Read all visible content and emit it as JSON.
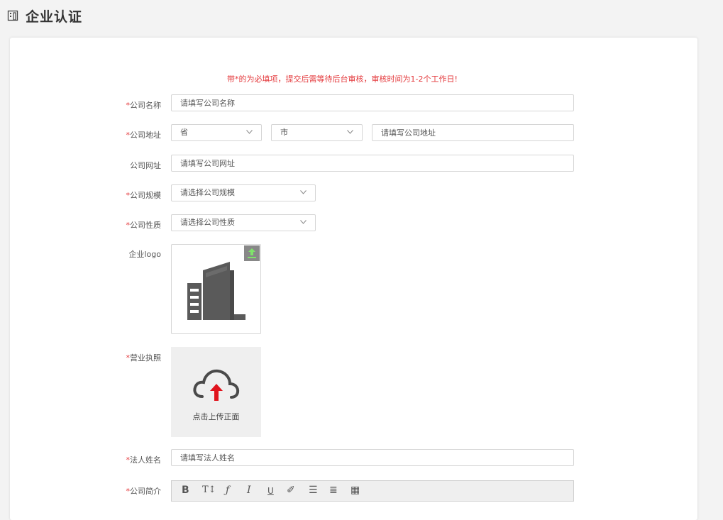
{
  "header": {
    "title": "企业认证",
    "icon": "building-icon"
  },
  "notice": "带*的为必填项，提交后需等待后台审核，审核时间为1-2个工作日!",
  "required_mark": "*",
  "fields": {
    "company_name": {
      "label": "公司名称",
      "placeholder": "请填写公司名称"
    },
    "company_address": {
      "label": "公司地址",
      "province": "省",
      "city": "市",
      "placeholder": "请填写公司地址"
    },
    "company_website": {
      "label": "公司网址",
      "placeholder": "请填写公司网址"
    },
    "company_scale": {
      "label": "公司规模",
      "value": "请选择公司规模"
    },
    "company_type": {
      "label": "公司性质",
      "value": "请选择公司性质"
    },
    "company_logo": {
      "label": "企业logo"
    },
    "business_license": {
      "label": "营业执照",
      "upload_caption": "点击上传正面"
    },
    "legal_person": {
      "label": "法人姓名",
      "placeholder": "请填写法人姓名"
    },
    "company_intro": {
      "label": "公司简介"
    }
  },
  "editor_toolbar": [
    {
      "name": "bold",
      "glyph": "B"
    },
    {
      "name": "font-size",
      "glyph": "T↕"
    },
    {
      "name": "font-family",
      "glyph": "ƒ"
    },
    {
      "name": "italic",
      "glyph": "I"
    },
    {
      "name": "underline",
      "glyph": "U"
    },
    {
      "name": "highlight",
      "glyph": "✐"
    },
    {
      "name": "list",
      "glyph": "☰"
    },
    {
      "name": "align",
      "glyph": "≣"
    },
    {
      "name": "table",
      "glyph": "▦"
    }
  ],
  "colors": {
    "required": "#e4393c",
    "upload_arrow": "#e0141d",
    "upload_badge_arrow": "#7fe36b"
  }
}
